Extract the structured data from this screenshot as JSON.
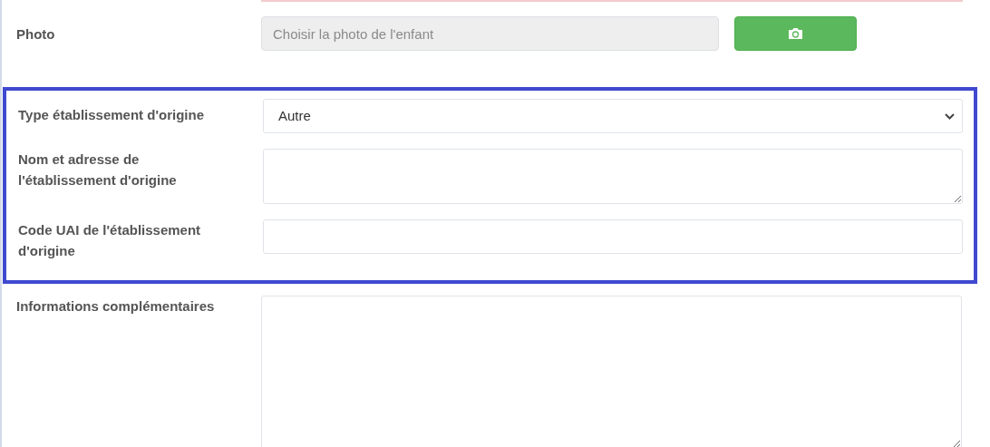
{
  "groups": [
    {
      "highlighted": false,
      "fields": [
        {
          "kind": "photo",
          "label": "Photo",
          "placeholder": "Choisir la photo de l'enfant"
        }
      ]
    },
    {
      "highlighted": true,
      "fields": [
        {
          "kind": "select",
          "label": "Type établissement d'origine",
          "value": "Autre"
        },
        {
          "kind": "textarea",
          "label": "Nom et adresse de l'établissement d'origine"
        },
        {
          "kind": "input",
          "label": "Code UAI de l'établissement d'origine"
        }
      ]
    },
    {
      "highlighted": false,
      "fields": [
        {
          "kind": "notes",
          "label": "Informations complémentaires"
        }
      ]
    }
  ]
}
